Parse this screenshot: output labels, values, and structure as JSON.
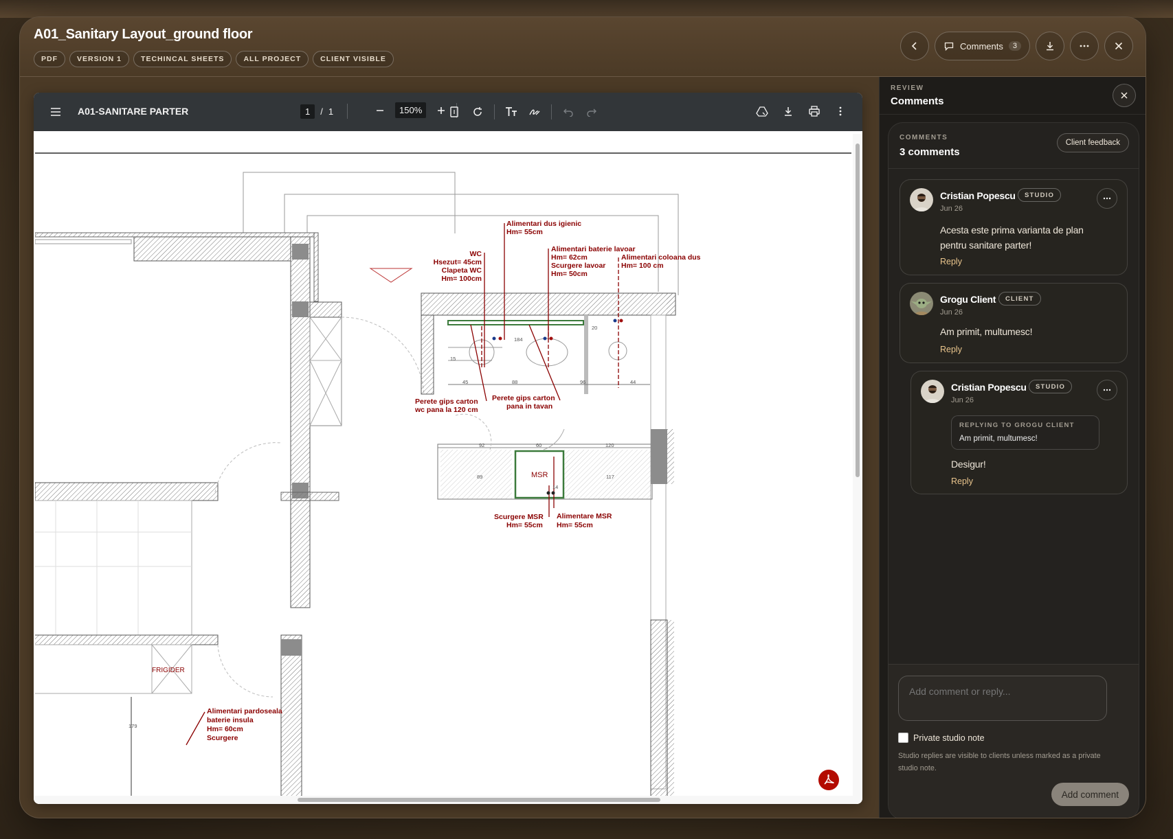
{
  "header": {
    "title": "A01_Sanitary Layout_ground floor",
    "tags": [
      "PDF",
      "VERSION 1",
      "TECHINCAL SHEETS",
      "ALL PROJECT",
      "CLIENT VISIBLE"
    ],
    "comments_label": "Comments",
    "comments_count": "3"
  },
  "viewer": {
    "doc_title": "A01-SANITARE PARTER",
    "page_current": "1",
    "page_sep": "/",
    "page_total": "1",
    "zoom": "150%",
    "drawing": {
      "labels": {
        "dus": "Alimentari dus igienic",
        "dus_h": "Hm= 55cm",
        "wc": "WC",
        "wc_1": "Hsezut= 45cm",
        "wc_2": "Clapeta WC",
        "wc_3": "Hm= 100cm",
        "lav": "Alimentari baterie lavoar",
        "lav_1": "Hm= 62cm",
        "lav_2": "Scurgere lavoar",
        "lav_3": "Hm= 50cm",
        "col": "Alimentari coloana dus",
        "col_1": "Hm= 100 cm",
        "pg1": "Perete gips carton",
        "pg1_b": "wc pana la 120 cm",
        "pg2": "Perete gips carton",
        "pg2_b": "pana in  tavan",
        "msr": "MSR",
        "scmsr": "Scurgere MSR",
        "scmsr_h": "Hm= 55cm",
        "almsr": "Alimentare MSR",
        "almsr_h": "Hm= 55cm",
        "frig": "FRIGIDER",
        "pard": "Alimentari pardoseala",
        "pard_1": "baterie insula",
        "pard_2": "Hm= 60cm",
        "pard_3": "Scurgere",
        "d15": "15",
        "d45": "45",
        "d88": "88",
        "d96": "96",
        "d44": "44",
        "d184": "184",
        "d20": "20",
        "d92": "92",
        "d60": "60",
        "d120": "120",
        "d89": "89",
        "d117": "117",
        "d14": "14",
        "d179": "179"
      }
    }
  },
  "panel": {
    "kicker": "REVIEW",
    "title": "Comments",
    "card_kicker": "COMMENTS",
    "card_title": "3 comments",
    "client_feedback": "Client feedback",
    "comments": [
      {
        "name": "Cristian Popescu",
        "badge": "STUDIO",
        "date": "Jun 26",
        "text_1": "Acesta este prima varianta de plan",
        "text_2": "pentru sanitare parter!",
        "reply": "Reply"
      },
      {
        "name": "Grogu Client",
        "badge": "CLIENT",
        "date": "Jun 26",
        "text_1": "Am primit, multumesc!",
        "reply": "Reply"
      },
      {
        "name": "Cristian Popescu",
        "badge": "STUDIO",
        "date": "Jun 26",
        "quote_label": "REPLYING TO GROGU CLIENT",
        "quote_text": "Am primit, multumesc!",
        "text_1": "Desigur!",
        "reply": "Reply"
      }
    ],
    "composer": {
      "placeholder": "Add comment or reply...",
      "private_label": "Private studio note",
      "help": "Studio replies are visible to clients unless marked as a private studio note.",
      "add_button": "Add comment"
    }
  }
}
